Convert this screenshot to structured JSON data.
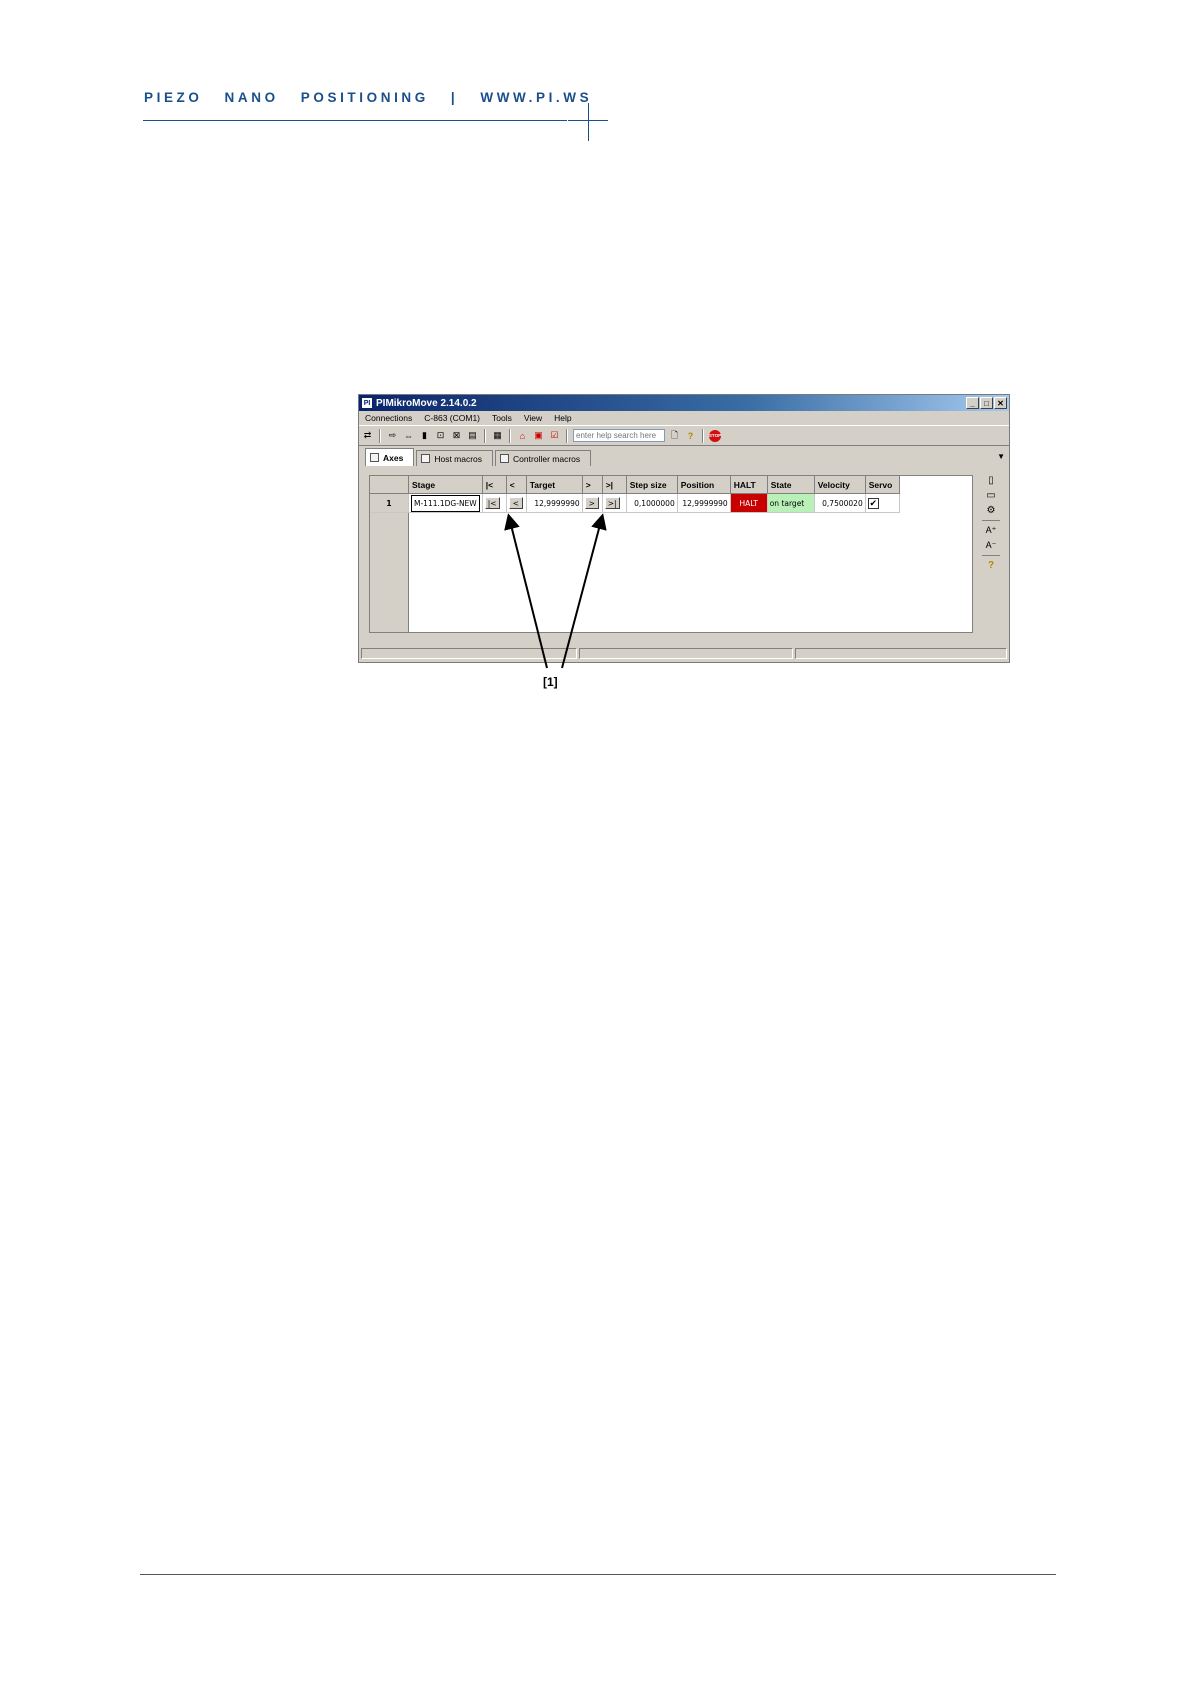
{
  "header": {
    "brand": "PIEZO   NANO   POSITIONING   |   WWW.PI.WS"
  },
  "window": {
    "title": "PIMikroMove  2.14.0.2",
    "icon_text": "PI",
    "controls": [
      "_",
      "□",
      "✕"
    ]
  },
  "menu": [
    "Connections",
    "C-863 (COM1)",
    "Tools",
    "View",
    "Help"
  ],
  "toolbar": {
    "search_placeholder": "enter help search here",
    "stop_label": "STOP"
  },
  "tabs": [
    {
      "label": "Axes",
      "active": true
    },
    {
      "label": "Host macros",
      "active": false
    },
    {
      "label": "Controller macros",
      "active": false
    }
  ],
  "grid": {
    "headers": [
      "Stage",
      "|<",
      "<",
      "Target",
      ">",
      ">|",
      "Step size",
      "Position",
      "HALT",
      "State",
      "Velocity",
      "Servo"
    ],
    "rows": [
      {
        "index": "1",
        "stage": "M-111.1DG-NEW",
        "btn_home": "|<",
        "btn_back": "<",
        "target": "12,9999990",
        "btn_fwd": ">",
        "btn_end": ">|",
        "step_size": "0,1000000",
        "position": "12,9999990",
        "halt": "HALT",
        "state": "on target",
        "velocity": "0,7500020",
        "servo": "✔"
      }
    ]
  },
  "annotation": {
    "label": "[1]"
  }
}
